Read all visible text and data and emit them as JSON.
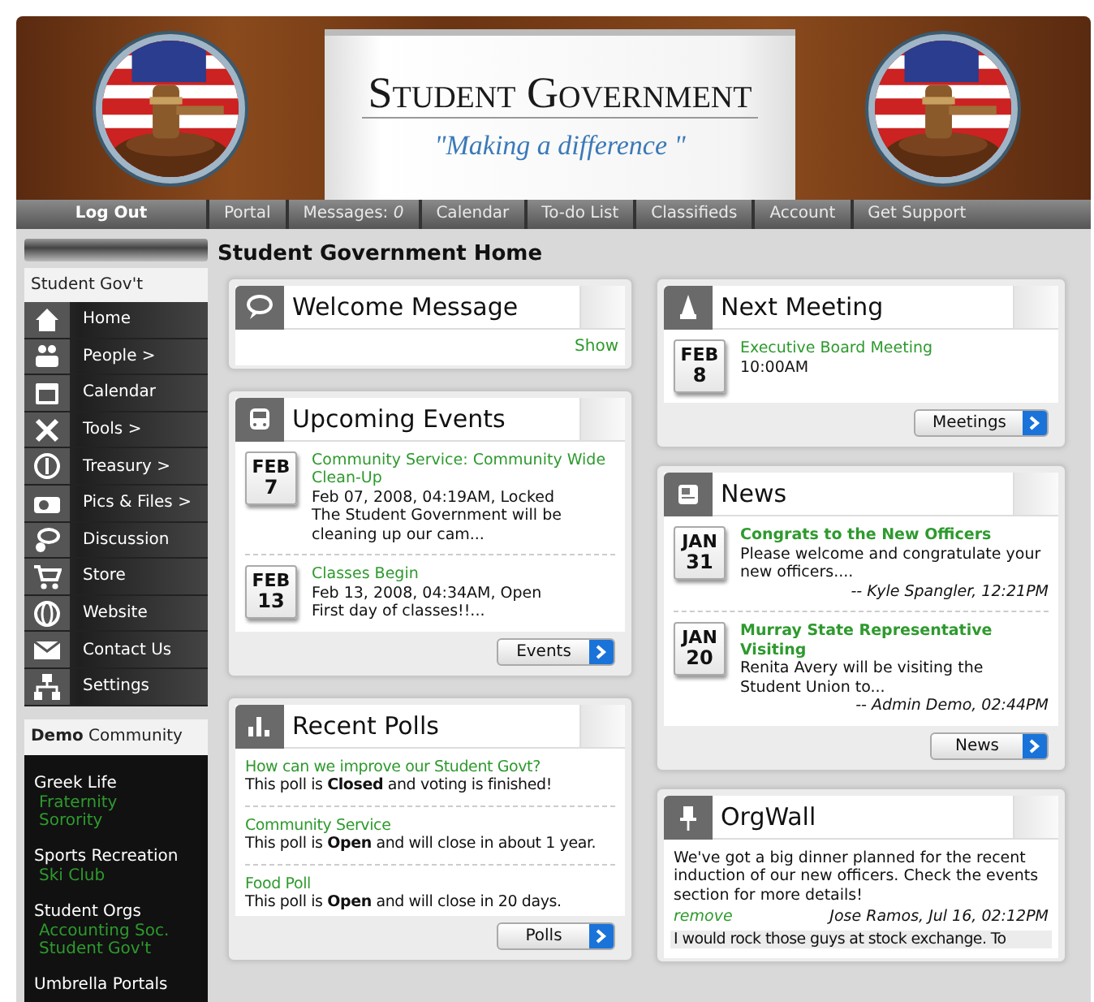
{
  "header": {
    "title": "Student Government",
    "tagline": "\"Making a difference \""
  },
  "nav": [
    {
      "label": "Log Out",
      "kind": "logout"
    },
    {
      "label": "Portal",
      "kind": "link"
    },
    {
      "label": "Messages: *0*",
      "kind": "link"
    },
    {
      "label": "Calendar",
      "kind": "link"
    },
    {
      "label": "To-do List",
      "kind": "link"
    },
    {
      "label": "Classifieds",
      "kind": "link"
    },
    {
      "label": "Account",
      "kind": "link"
    },
    {
      "label": "Get Support",
      "kind": "link"
    }
  ],
  "sidebar": {
    "title": "Student Gov't",
    "items": [
      {
        "label": "Home"
      },
      {
        "label": "People >"
      },
      {
        "label": "Calendar"
      },
      {
        "label": "Tools >"
      },
      {
        "label": "Treasury >"
      },
      {
        "label": "Pics & Files >"
      },
      {
        "label": "Discussion"
      },
      {
        "label": "Store"
      },
      {
        "label": "Website"
      },
      {
        "label": "Contact Us"
      },
      {
        "label": "Settings"
      }
    ],
    "community_title": "**Demo** Community",
    "groups": [
      {
        "label": "Greek Life",
        "children": [
          {
            "label": "Fraternity"
          },
          {
            "label": "Sorority"
          }
        ]
      },
      {
        "label": "Sports Recreation",
        "children": [
          {
            "label": "Ski Club"
          }
        ]
      },
      {
        "label": "Student Orgs",
        "children": [
          {
            "label": "Accounting Soc."
          },
          {
            "label": "Student Gov't"
          }
        ]
      },
      {
        "label": "Umbrella Portals"
      }
    ]
  },
  "page_title": "Student Government Home",
  "left_column": [
    {
      "kind": "welcome",
      "title": "Welcome Message",
      "link": "Show"
    },
    {
      "kind": "events",
      "title": "Upcoming Events",
      "items": [
        {
          "month": "FEB",
          "day": "7",
          "title": "Community Service: Community Wide Clean-Up",
          "meta": "Feb 07, 2008, 04:19AM, Locked",
          "excerpt": "The Student Government will be cleaning up our cam..."
        },
        {
          "month": "FEB",
          "day": "13",
          "title": "Classes Begin",
          "meta": "Feb 13, 2008, 04:34AM, Open",
          "excerpt": "First day of classes!!..."
        }
      ],
      "button": "Events"
    },
    {
      "kind": "polls",
      "title": "Recent Polls",
      "items": [
        {
          "question": "How can we improve our Student Govt?",
          "status": "This poll is **Closed** and voting is finished!"
        },
        {
          "question": "Community Service",
          "status": "This poll is **Open** and will close in about 1 year."
        },
        {
          "question": "Food Poll",
          "status": "This poll is **Open** and will close in 20 days."
        }
      ],
      "button": "Polls"
    }
  ],
  "right_column": [
    {
      "kind": "meeting",
      "title": "Next Meeting",
      "items": [
        {
          "month": "FEB",
          "day": "8",
          "title": "Executive Board Meeting",
          "time": "10:00AM"
        }
      ],
      "button": "Meetings"
    },
    {
      "kind": "news",
      "title": "News",
      "items": [
        {
          "month": "JAN",
          "day": "31",
          "title": "Congrats to the New Officers",
          "excerpt": "Please welcome and congratulate your new officers....",
          "byline": "-- Kyle Spangler, 12:21PM"
        },
        {
          "month": "JAN",
          "day": "20",
          "title": "Murray State Representative Visiting",
          "excerpt": "Renita Avery will be visiting the Student Union to...",
          "byline": "-- Admin Demo, 02:44PM"
        }
      ],
      "button": "News"
    },
    {
      "kind": "wall",
      "title": "OrgWall",
      "posts": [
        {
          "text": "We've got a big dinner planned for the recent induction of our new officers. Check the events section for more details!",
          "action": "remove",
          "byline": "Jose Ramos, Jul 16, 02:12PM"
        },
        {
          "text": "I would rock those guys at stock exchange. To"
        }
      ]
    }
  ]
}
